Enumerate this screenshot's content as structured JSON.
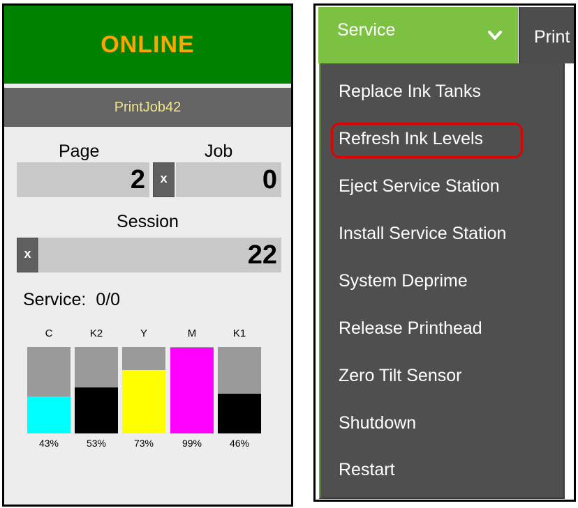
{
  "status": {
    "state": "ONLINE",
    "state_color": "#008200",
    "state_text_color": "#ffa500",
    "job_name": "PrintJob42"
  },
  "counters": {
    "page_label": "Page",
    "job_label": "Job",
    "page_value": "2",
    "job_value": "0",
    "session_label": "Session",
    "session_value": "22",
    "reset_label": "x"
  },
  "service": {
    "label": "Service:",
    "value": "0/0"
  },
  "ink": [
    {
      "name": "C",
      "percent_label": "43%",
      "level": 0.43,
      "color": "#00ffff"
    },
    {
      "name": "K2",
      "percent_label": "53%",
      "level": 0.53,
      "color": "#000000"
    },
    {
      "name": "Y",
      "percent_label": "73%",
      "level": 0.73,
      "color": "#ffff00"
    },
    {
      "name": "M",
      "percent_label": "99%",
      "level": 0.99,
      "color": "#ff00ff"
    },
    {
      "name": "K1",
      "percent_label": "46%",
      "level": 0.46,
      "color": "#000000"
    }
  ],
  "menu": {
    "dropdown_label": "Service",
    "dropdown_icon": "chevron-down-icon",
    "next_tab_label": "Print",
    "accent_color": "#7dc142",
    "items": [
      "Replace Ink Tanks",
      "Refresh Ink Levels",
      "Eject Service Station",
      "Install Service Station",
      "System Deprime",
      "Release Printhead",
      "Zero Tilt Sensor",
      "Shutdown",
      "Restart"
    ],
    "highlighted_item": "Refresh Ink Levels",
    "highlight_color": "#e00000"
  }
}
